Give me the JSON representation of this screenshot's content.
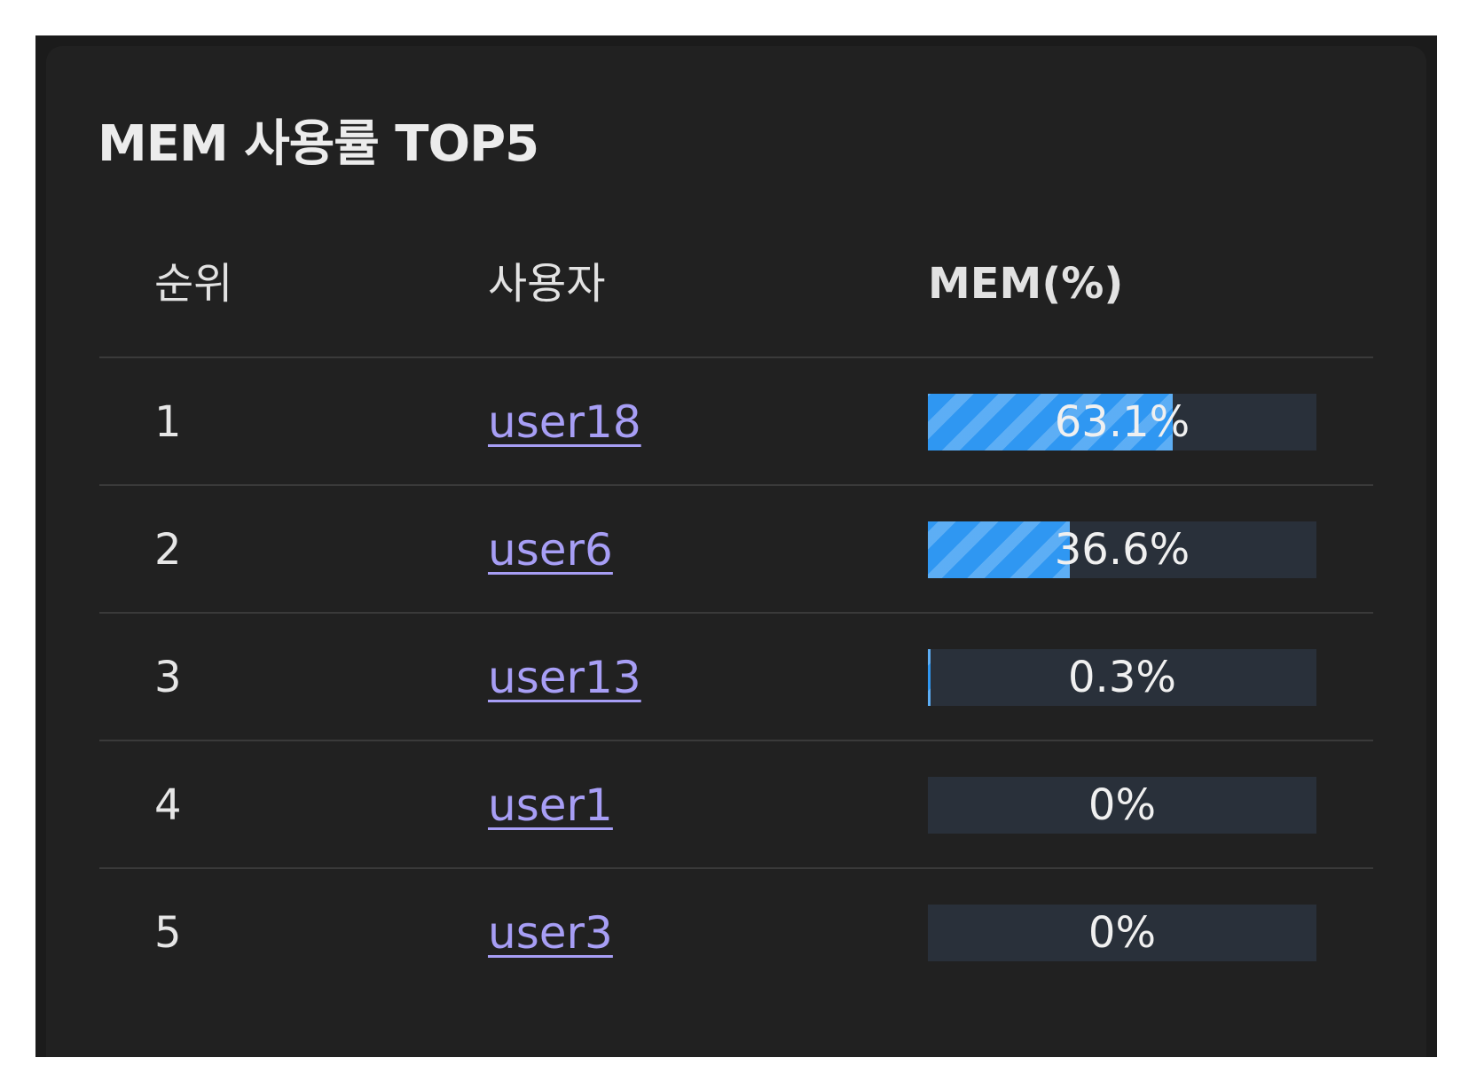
{
  "panel": {
    "title": "MEM 사용률 TOP5",
    "columns": {
      "rank": "순위",
      "user": "사용자",
      "mem": "MEM(%)"
    },
    "rows": [
      {
        "rank": "1",
        "user": "user18",
        "mem_label": "63.1%",
        "mem_value": 63.1
      },
      {
        "rank": "2",
        "user": "user6",
        "mem_label": "36.6%",
        "mem_value": 36.6
      },
      {
        "rank": "3",
        "user": "user13",
        "mem_label": "0.3%",
        "mem_value": 0.3
      },
      {
        "rank": "4",
        "user": "user1",
        "mem_label": "0%",
        "mem_value": 0
      },
      {
        "rank": "5",
        "user": "user3",
        "mem_label": "0%",
        "mem_value": 0
      }
    ]
  },
  "colors": {
    "background": "#212121",
    "bar_track": "#29303a",
    "bar_fill": "#2f97f2",
    "link": "#a79ef5",
    "divider": "#3a3a3a"
  }
}
